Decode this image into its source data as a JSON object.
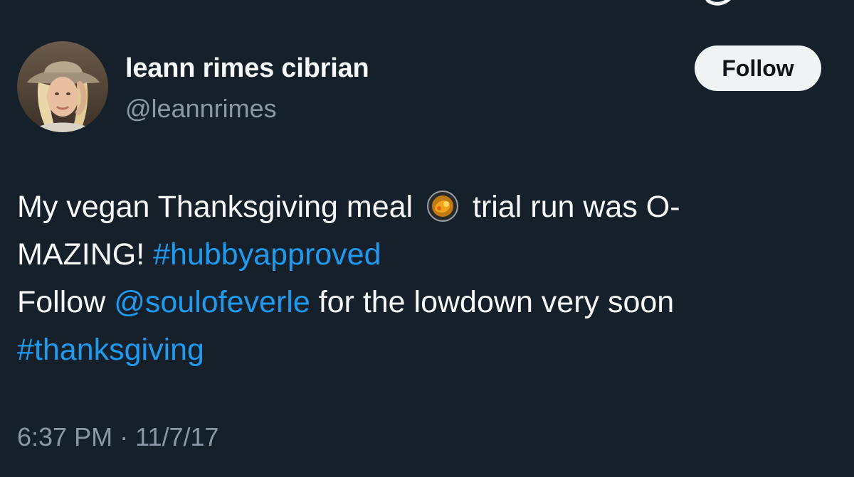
{
  "colors": {
    "background": "#15202b",
    "primary_text": "#f7f9f9",
    "secondary_text": "#8b98a5",
    "link": "#1d9bf0",
    "follow_button_bg": "#eff3f4",
    "follow_button_text": "#0f1419"
  },
  "top_bar": {
    "icon": "partially-visible-icon"
  },
  "author": {
    "display_name": "leann rimes cibrian",
    "handle": "@leannrimes",
    "avatar_icon": "profile-photo-woman-in-hat"
  },
  "follow_button": {
    "label": "Follow"
  },
  "tweet": {
    "line1_text_a": "My vegan Thanksgiving meal",
    "emoji": "shallow-pan-of-food-emoji",
    "line1_text_b": "trial run was O-",
    "line2_text": "MAZING!",
    "hashtag1": "#hubbyapproved",
    "line3_text_a": "Follow",
    "mention": "@soulofeverle",
    "line3_text_b": "for the lowdown very soon",
    "hashtag2": "#thanksgiving"
  },
  "meta": {
    "time": "6:37 PM",
    "separator": "·",
    "date": "11/7/17"
  }
}
